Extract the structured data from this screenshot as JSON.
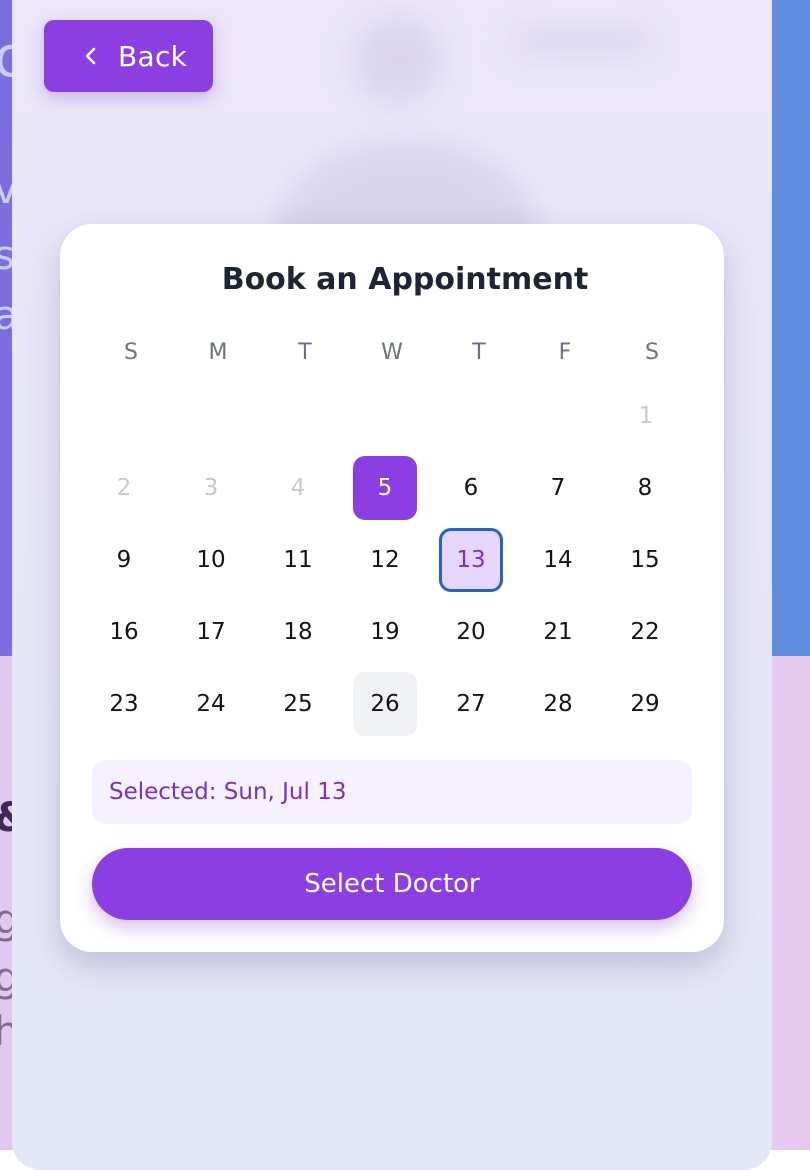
{
  "background": {
    "edge_glyphs": [
      "o",
      "v",
      "s",
      "a",
      "&",
      "g",
      "g",
      "h"
    ]
  },
  "back_button": {
    "label": "Back",
    "icon": "chevron-left-icon"
  },
  "card": {
    "title": "Book an Appointment",
    "weekdays": [
      "S",
      "M",
      "T",
      "W",
      "T",
      "F",
      "S"
    ],
    "weeks": [
      [
        null,
        null,
        null,
        null,
        null,
        null,
        {
          "day": "1",
          "state": "disabled"
        }
      ],
      [
        {
          "day": "2",
          "state": "disabled"
        },
        {
          "day": "3",
          "state": "disabled"
        },
        {
          "day": "4",
          "state": "disabled"
        },
        {
          "day": "5",
          "state": "today"
        },
        {
          "day": "6",
          "state": "normal"
        },
        {
          "day": "7",
          "state": "normal"
        },
        {
          "day": "8",
          "state": "normal"
        }
      ],
      [
        {
          "day": "9",
          "state": "normal"
        },
        {
          "day": "10",
          "state": "normal"
        },
        {
          "day": "11",
          "state": "normal"
        },
        {
          "day": "12",
          "state": "normal"
        },
        {
          "day": "13",
          "state": "selected"
        },
        {
          "day": "14",
          "state": "normal"
        },
        {
          "day": "15",
          "state": "normal"
        }
      ],
      [
        {
          "day": "16",
          "state": "normal"
        },
        {
          "day": "17",
          "state": "normal"
        },
        {
          "day": "18",
          "state": "normal"
        },
        {
          "day": "19",
          "state": "normal"
        },
        {
          "day": "20",
          "state": "normal"
        },
        {
          "day": "21",
          "state": "normal"
        },
        {
          "day": "22",
          "state": "normal"
        }
      ],
      [
        {
          "day": "23",
          "state": "normal"
        },
        {
          "day": "24",
          "state": "normal"
        },
        {
          "day": "25",
          "state": "normal"
        },
        {
          "day": "26",
          "state": "hover"
        },
        {
          "day": "27",
          "state": "normal"
        },
        {
          "day": "28",
          "state": "normal"
        },
        {
          "day": "29",
          "state": "normal"
        }
      ]
    ],
    "selected_text": "Selected: Sun, Jul 13",
    "action_button": "Select Doctor"
  },
  "colors": {
    "accent": "#8b3ee2",
    "selected_bg": "#e5d6fb",
    "selected_border": "#2a61c9",
    "title_text": "#1e2433"
  }
}
